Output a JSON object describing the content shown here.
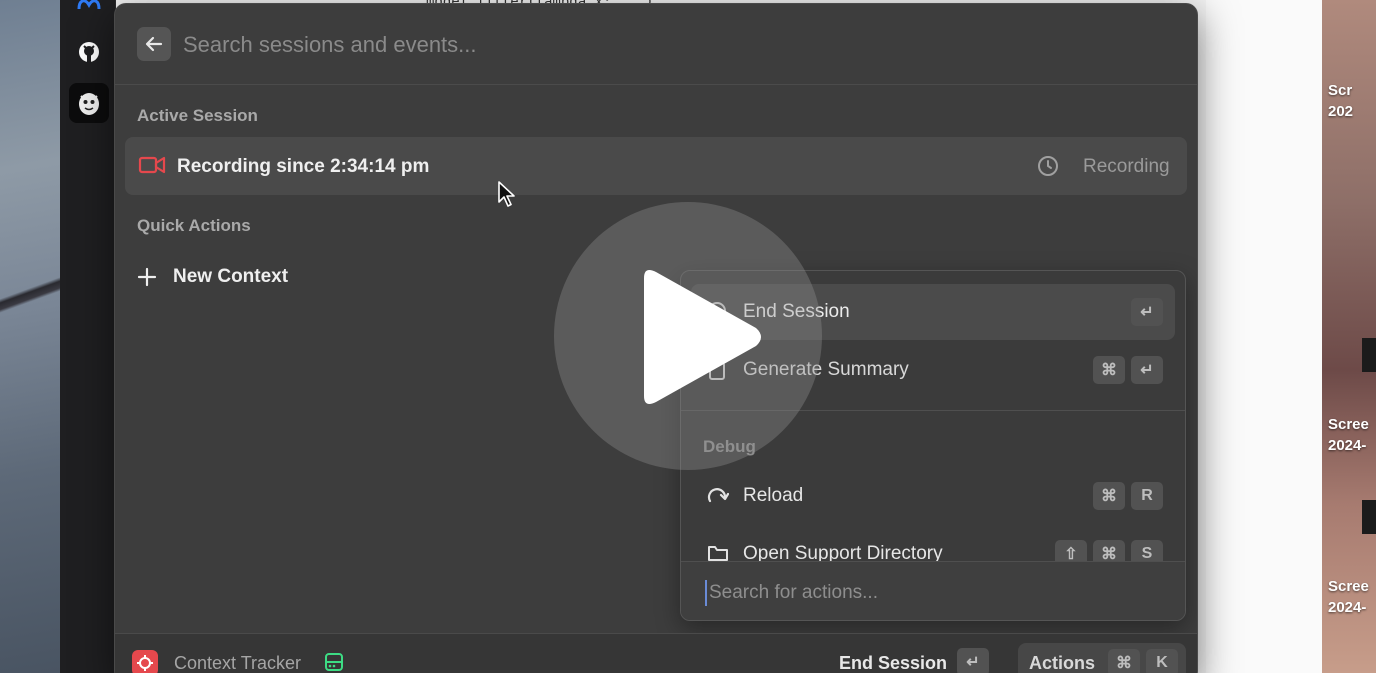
{
  "background": {
    "behind_code_text": "model.filter(lambda x: ...)",
    "desktop_labels": [
      "Scr",
      "202",
      "Scree",
      "2024-",
      "Scree",
      "2024-"
    ]
  },
  "dock": {
    "items": [
      {
        "icon": "meta-icon"
      },
      {
        "icon": "github-icon"
      },
      {
        "icon": "app-avatar-icon",
        "active": true
      }
    ]
  },
  "search": {
    "placeholder": "Search sessions and events..."
  },
  "active_session": {
    "heading": "Active Session",
    "text": "Recording since 2:34:14 pm",
    "status": "Recording",
    "icon": "video-camera-icon",
    "accent": "#e5484d"
  },
  "quick_actions": {
    "heading": "Quick Actions",
    "items": [
      {
        "label": "New Context",
        "icon": "plus-icon"
      }
    ]
  },
  "actions_menu": {
    "items": [
      {
        "label": "End Session",
        "icon": "stop-icon",
        "keys": [
          "↵"
        ],
        "selected": true
      },
      {
        "label": "Generate Summary",
        "icon": "clipboard-icon",
        "keys": [
          "⌘",
          "↵"
        ]
      }
    ],
    "debug_heading": "Debug",
    "debug_items": [
      {
        "label": "Reload",
        "icon": "reload-icon",
        "keys": [
          "⌘",
          "R"
        ]
      },
      {
        "label": "Open Support Directory",
        "icon": "folder-icon",
        "keys": [
          "⇧",
          "⌘",
          "S"
        ]
      }
    ],
    "search_placeholder": "Search for actions..."
  },
  "footer": {
    "app_name": "Context Tracker",
    "primary_action": "End Session",
    "primary_key": "↵",
    "actions_label": "Actions",
    "actions_keys": [
      "⌘",
      "K"
    ]
  }
}
